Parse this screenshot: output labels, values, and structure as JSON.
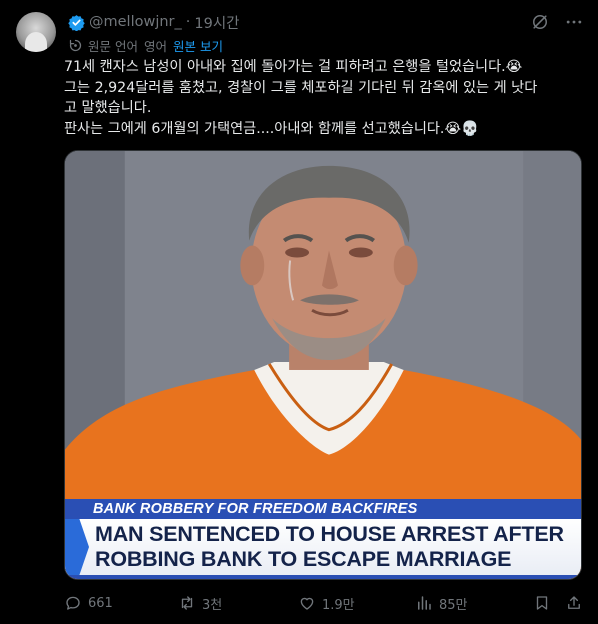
{
  "author": {
    "handle": "@mellowjnr_",
    "separator": "·",
    "time": "19시간"
  },
  "translation": {
    "label": "원문 언어",
    "separator": "·",
    "language": "영어",
    "show_original": "원본 보기"
  },
  "tweet": {
    "lines": [
      "71세 캔자스 남성이 아내와 집에 돌아가는 걸 피하려고 은행을 털었습니다.😭",
      "그는 2,924달러를 훔쳤고, 경찰이 그를 체포하길 기다린 뒤 감옥에 있는 게 낫다",
      "고 말했습니다.",
      "판사는 그에게 6개월의 가택연금....아내와 함께를 선고했습니다.😭💀"
    ]
  },
  "media": {
    "banner_top": "BANK ROBBERY FOR FREEDOM BACKFIRES",
    "headline_1": "MAN SENTENCED TO HOUSE ARREST AFTER",
    "headline_2": "ROBBING BANK TO ESCAPE MARRIAGE"
  },
  "actions": {
    "replies": "661",
    "reposts": "3천",
    "likes": "1.9만",
    "views": "85만"
  },
  "colors": {
    "background": "#000000",
    "text": "#e7e9ea",
    "muted": "#71767b",
    "accent": "#1d9bf0",
    "jumpsuit": "#e8731e"
  },
  "icons": {
    "verified": "verified-badge-icon",
    "grok": "grok-icon",
    "more": "more-icon",
    "translate": "translate-icon",
    "reply": "reply-icon",
    "repost": "repost-icon",
    "like": "like-icon",
    "views": "views-icon",
    "bookmark": "bookmark-icon",
    "share": "share-icon"
  }
}
